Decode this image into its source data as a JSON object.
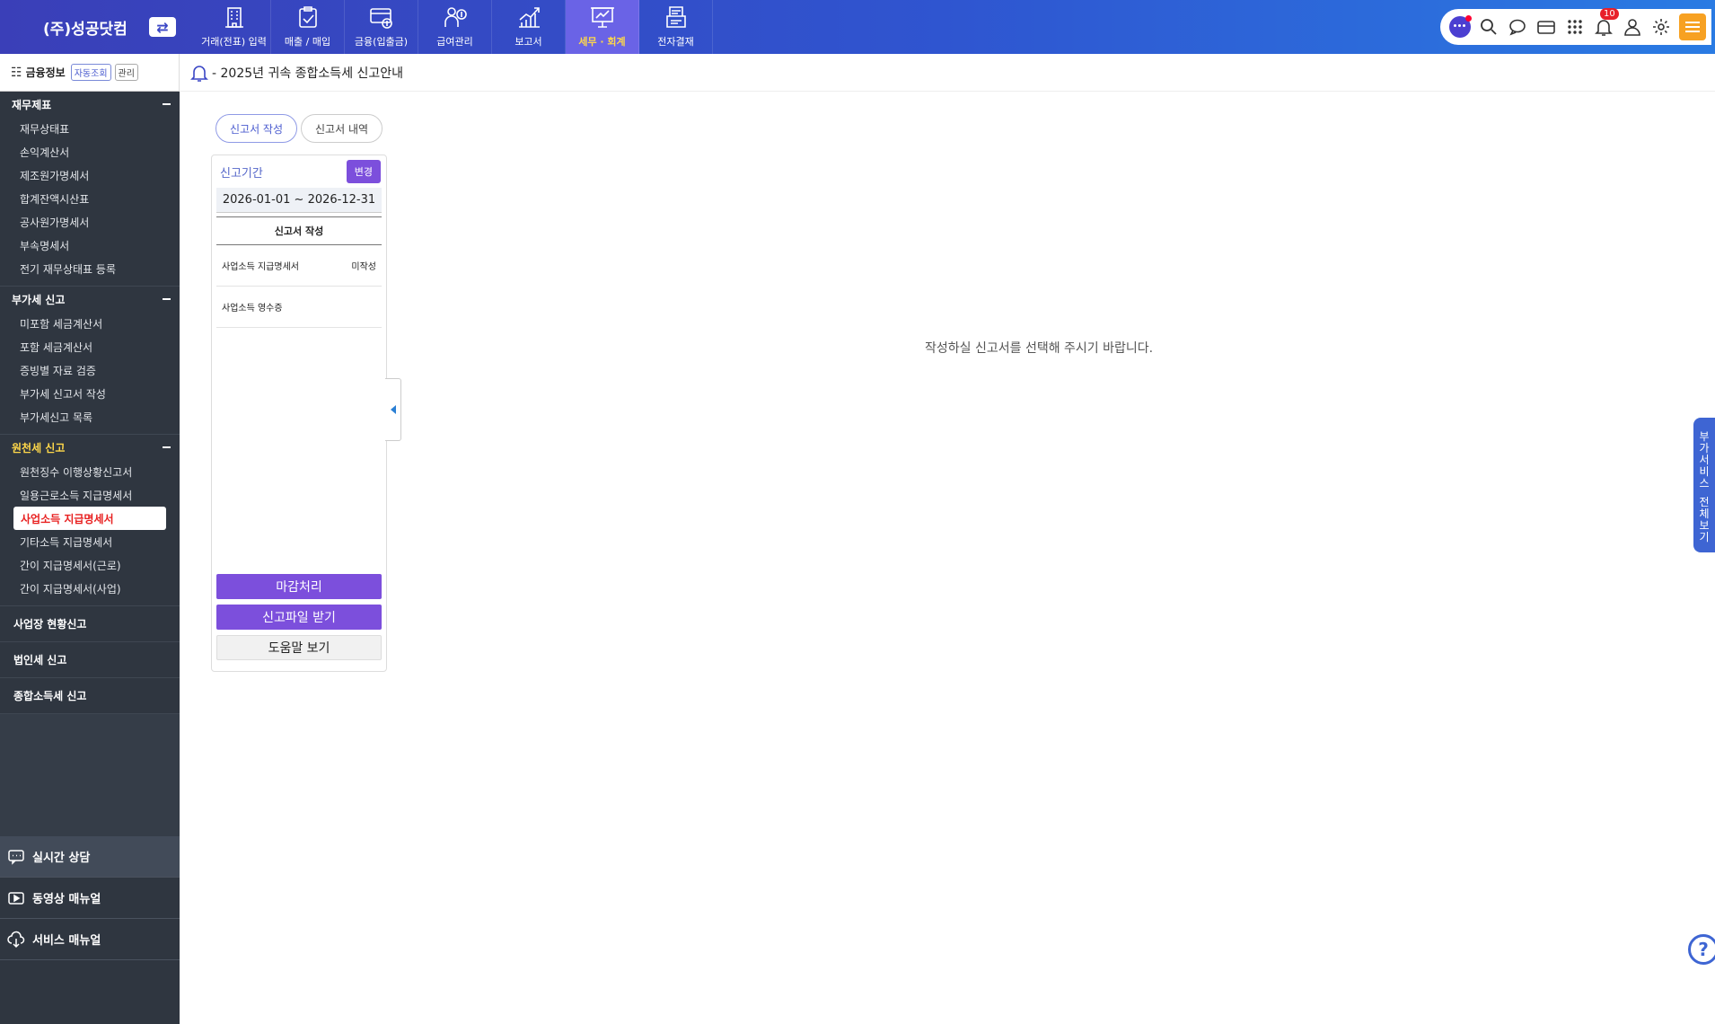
{
  "brand": {
    "name": "(주)성공닷컴",
    "switch_icon": "swap-icon"
  },
  "topnav": [
    {
      "label": "거래(전표) 입력",
      "icon": "building-icon"
    },
    {
      "label": "매출 / 매입",
      "icon": "clipboard-check-icon"
    },
    {
      "label": "금융(입출금)",
      "icon": "bank-card-icon"
    },
    {
      "label": "급여관리",
      "icon": "payroll-icon"
    },
    {
      "label": "보고서",
      "icon": "chart-up-icon"
    },
    {
      "label": "세무 · 회계",
      "icon": "presentation-icon",
      "active": true
    },
    {
      "label": "전자결재",
      "icon": "approval-icon"
    }
  ],
  "tools": {
    "notification_count": "10"
  },
  "sidebar": {
    "finance": {
      "title": "금융정보",
      "auto_label": "자동조회",
      "manage_label": "관리"
    },
    "sections": [
      {
        "title": "재무제표",
        "items": [
          "재무상태표",
          "손익계산서",
          "제조원가명세서",
          "합계잔액시산표",
          "공사원가명세서",
          "부속명세서",
          "전기 재무상태표 등록"
        ]
      },
      {
        "title": "부가세 신고",
        "items": [
          "미포함 세금계산서",
          "포함 세금계산서",
          "증빙별 자료 검증",
          "부가세 신고서 작성",
          "부가세신고 목록"
        ]
      },
      {
        "title": "원천세 신고",
        "items": [
          "원천징수 이행상황신고서",
          "일용근로소득 지급명세서",
          "사업소득 지급명세서",
          "기타소득 지급명세서",
          "간이 지급명세서(근로)",
          "간이 지급명세서(사업)"
        ],
        "active_index": 2
      }
    ],
    "plain_items": [
      "사업장 현황신고",
      "법인세 신고",
      "종합소득세 신고"
    ],
    "help": [
      "실시간 상담",
      "동영상 매뉴얼",
      "서비스 매뉴얼"
    ]
  },
  "main": {
    "breadcrumb": "- 2025년 귀속 종합소득세 신고안내",
    "tabs": [
      "신고서 작성",
      "신고서 내역"
    ],
    "panel": {
      "period_label": "신고기간",
      "change_label": "변경",
      "period_value": "2026-01-01 ~ 2026-12-31",
      "write_header": "신고서 작성",
      "docs": [
        {
          "name": "사업소득 지급명세서",
          "status": "미작성"
        },
        {
          "name": "사업소득 영수증",
          "status": ""
        }
      ],
      "close_label": "마감처리",
      "download_label": "신고파일 받기",
      "help_label": "도움말 보기"
    },
    "empty_message": "작성하실 신고서를 선택해 주시기 바랍니다."
  },
  "side_tab": [
    "부",
    "가",
    "서",
    "비",
    "스",
    " ",
    "전",
    "체",
    "보",
    "기"
  ],
  "help_fab": "?"
}
